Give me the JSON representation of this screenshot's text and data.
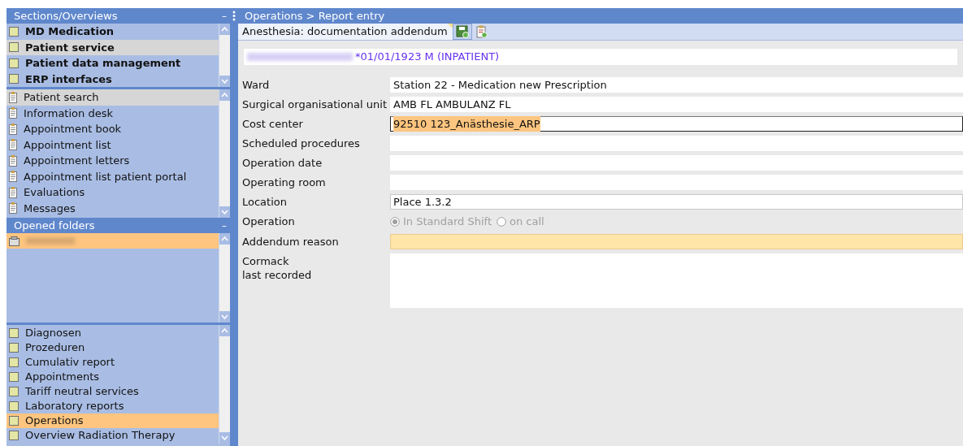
{
  "sidebar": {
    "title": "Sections/Overviews",
    "collapse": "–",
    "sections": [
      {
        "label": "MD Medication",
        "selected": false
      },
      {
        "label": "Patient service",
        "selected": true
      },
      {
        "label": "Patient data management",
        "selected": false
      },
      {
        "label": "ERP interfaces",
        "selected": false
      }
    ],
    "tools": [
      {
        "label": "Patient search",
        "selected": true
      },
      {
        "label": "Information desk",
        "selected": false
      },
      {
        "label": "Appointment book",
        "selected": false
      },
      {
        "label": "Appointment list",
        "selected": false
      },
      {
        "label": "Appointment letters",
        "selected": false
      },
      {
        "label": "Appointment list patient portal",
        "selected": false
      },
      {
        "label": "Evaluations",
        "selected": false
      },
      {
        "label": "Messages",
        "selected": false
      }
    ],
    "opened_folders": {
      "title": "Opened folders",
      "collapse": "–",
      "items": [
        {
          "selected": true
        }
      ]
    },
    "records": [
      {
        "label": "Diagnosen",
        "selected": false
      },
      {
        "label": "Prozeduren",
        "selected": false
      },
      {
        "label": "Cumulativ report",
        "selected": false
      },
      {
        "label": "Appointments",
        "selected": false
      },
      {
        "label": "Tariff neutral services",
        "selected": false
      },
      {
        "label": "Laboratory reports",
        "selected": false
      },
      {
        "label": "Operations",
        "selected": true
      },
      {
        "label": "Overview Radiation Therapy",
        "selected": false
      }
    ]
  },
  "main": {
    "breadcrumb": "Operations > Report entry",
    "tab": {
      "label": "Anesthesia: documentation addendum",
      "selected": true
    },
    "patient": {
      "info": "*01/01/1923 M (INPATIENT)"
    },
    "form": [
      {
        "kind": "text",
        "label": "Ward",
        "value": "Station 22 - Medication new Prescription"
      },
      {
        "kind": "text",
        "label": "Surgical organisational unit",
        "value": "AMB FL AMBULANZ FL"
      },
      {
        "kind": "text",
        "label": "Cost center",
        "value": "92510 123_Anästhesie_ARP",
        "focused": true
      },
      {
        "kind": "text",
        "label": "Scheduled procedures"
      },
      {
        "kind": "text",
        "label": "Operation date"
      },
      {
        "kind": "text",
        "label": "Operating room"
      },
      {
        "kind": "combo",
        "label": "Location",
        "value": "Place 1.3.2"
      },
      {
        "kind": "radio",
        "label": "Operation",
        "disabled": true,
        "options": [
          {
            "label": "In Standard Shift",
            "selected": true
          },
          {
            "label": "on call",
            "selected": false
          }
        ]
      },
      {
        "kind": "text",
        "label": "Addendum reason",
        "required": true
      },
      {
        "kind": "textarea",
        "label": "Cormack\nlast recorded"
      }
    ]
  }
}
